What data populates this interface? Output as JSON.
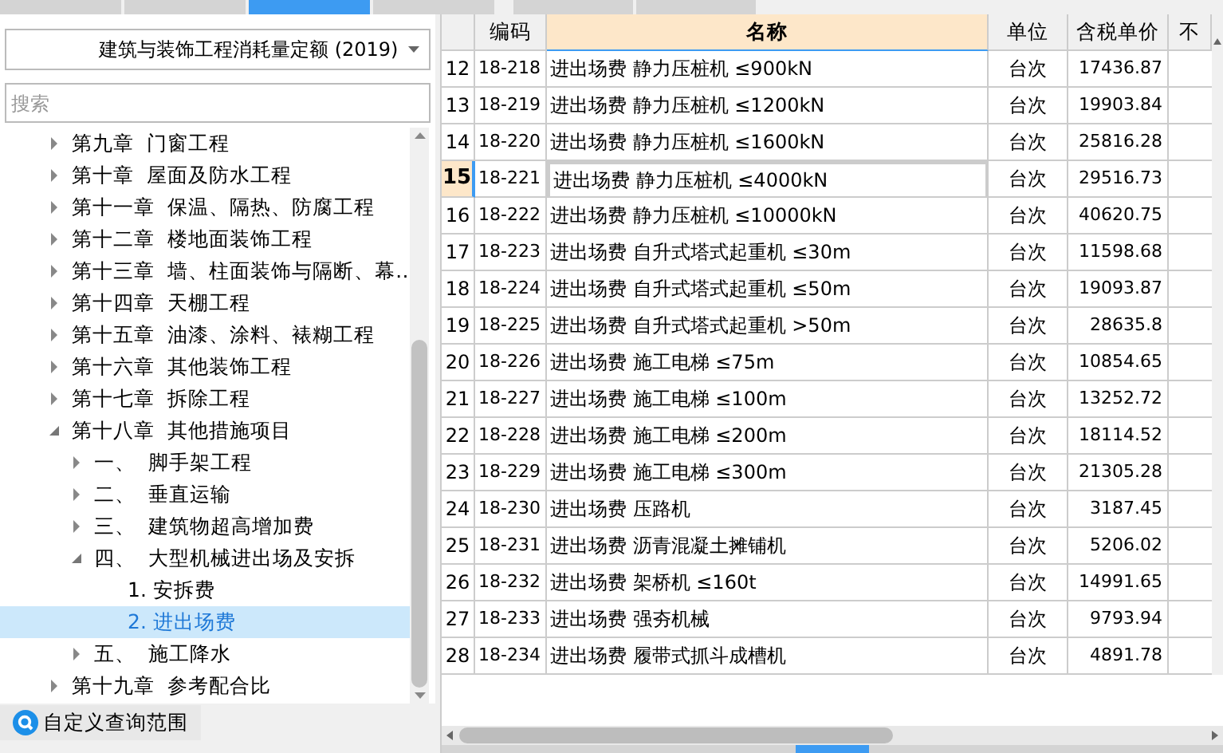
{
  "top_tabs": [
    {
      "selected": false
    },
    {
      "selected": false
    },
    {
      "selected": true
    },
    {
      "selected": false
    }
  ],
  "right_tabs": [
    {
      "selected": false
    },
    {
      "selected": false
    }
  ],
  "library_select": {
    "value": "建筑与装饰工程消耗量定额 (2019)"
  },
  "search": {
    "placeholder": "搜索"
  },
  "tree": [
    {
      "label": "第九章  门窗工程",
      "expanded": false,
      "selected": false
    },
    {
      "label": "第十章  屋面及防水工程",
      "expanded": false,
      "selected": false
    },
    {
      "label": "第十一章  保温、隔热、防腐工程",
      "expanded": false,
      "selected": false
    },
    {
      "label": "第十二章  楼地面装饰工程",
      "expanded": false,
      "selected": false
    },
    {
      "label": "第十三章  墙、柱面装饰与隔断、幕…",
      "expanded": false,
      "selected": false
    },
    {
      "label": "第十四章  天棚工程",
      "expanded": false,
      "selected": false
    },
    {
      "label": "第十五章  油漆、涂料、裱糊工程",
      "expanded": false,
      "selected": false
    },
    {
      "label": "第十六章  其他装饰工程",
      "expanded": false,
      "selected": false
    },
    {
      "label": "第十七章  拆除工程",
      "expanded": false,
      "selected": false
    },
    {
      "label": "第十八章  其他措施项目",
      "expanded": true,
      "selected": false,
      "children": [
        {
          "label": "一、  脚手架工程",
          "expanded": false,
          "selected": false
        },
        {
          "label": "二、  垂直运输",
          "expanded": false,
          "selected": false
        },
        {
          "label": "三、  建筑物超高增加费",
          "expanded": false,
          "selected": false
        },
        {
          "label": "四、  大型机械进出场及安拆",
          "expanded": true,
          "selected": false,
          "children": [
            {
              "label": "1. 安拆费",
              "selected": false
            },
            {
              "label": "2. 进出场费",
              "selected": true
            }
          ]
        },
        {
          "label": "五、  施工降水",
          "expanded": false,
          "selected": false
        }
      ]
    },
    {
      "label": "第十九章  参考配合比",
      "expanded": false,
      "selected": false
    }
  ],
  "custom_scope_button": {
    "label": "自定义查询范围"
  },
  "table": {
    "columns": [
      "编码",
      "名称",
      "单位",
      "含税单价",
      "不"
    ],
    "rows": [
      {
        "index": "12",
        "code": "18-218",
        "name": "进出场费 静力压桩机 ≤900kN",
        "unit": "台次",
        "price": "17436.87",
        "selected": false
      },
      {
        "index": "13",
        "code": "18-219",
        "name": "进出场费 静力压桩机 ≤1200kN",
        "unit": "台次",
        "price": "19903.84",
        "selected": false
      },
      {
        "index": "14",
        "code": "18-220",
        "name": "进出场费 静力压桩机 ≤1600kN",
        "unit": "台次",
        "price": "25816.28",
        "selected": false
      },
      {
        "index": "15",
        "code": "18-221",
        "name": "进出场费 静力压桩机 ≤4000kN",
        "unit": "台次",
        "price": "29516.73",
        "selected": true
      },
      {
        "index": "16",
        "code": "18-222",
        "name": "进出场费 静力压桩机 ≤10000kN",
        "unit": "台次",
        "price": "40620.75",
        "selected": false
      },
      {
        "index": "17",
        "code": "18-223",
        "name": "进出场费 自升式塔式起重机 ≤30m",
        "unit": "台次",
        "price": "11598.68",
        "selected": false
      },
      {
        "index": "18",
        "code": "18-224",
        "name": "进出场费 自升式塔式起重机 ≤50m",
        "unit": "台次",
        "price": "19093.87",
        "selected": false
      },
      {
        "index": "19",
        "code": "18-225",
        "name": "进出场费 自升式塔式起重机 >50m",
        "unit": "台次",
        "price": "28635.8",
        "selected": false
      },
      {
        "index": "20",
        "code": "18-226",
        "name": "进出场费 施工电梯 ≤75m",
        "unit": "台次",
        "price": "10854.65",
        "selected": false
      },
      {
        "index": "21",
        "code": "18-227",
        "name": "进出场费 施工电梯 ≤100m",
        "unit": "台次",
        "price": "13252.72",
        "selected": false
      },
      {
        "index": "22",
        "code": "18-228",
        "name": "进出场费 施工电梯 ≤200m",
        "unit": "台次",
        "price": "18114.52",
        "selected": false
      },
      {
        "index": "23",
        "code": "18-229",
        "name": "进出场费 施工电梯 ≤300m",
        "unit": "台次",
        "price": "21305.28",
        "selected": false
      },
      {
        "index": "24",
        "code": "18-230",
        "name": "进出场费 压路机",
        "unit": "台次",
        "price": "3187.45",
        "selected": false
      },
      {
        "index": "25",
        "code": "18-231",
        "name": "进出场费 沥青混凝土摊铺机",
        "unit": "台次",
        "price": "5206.02",
        "selected": false
      },
      {
        "index": "26",
        "code": "18-232",
        "name": "进出场费 架桥机 ≤160t",
        "unit": "台次",
        "price": "14991.65",
        "selected": false
      },
      {
        "index": "27",
        "code": "18-233",
        "name": "进出场费 强夯机械",
        "unit": "台次",
        "price": "9793.94",
        "selected": false
      },
      {
        "index": "28",
        "code": "18-234",
        "name": "进出场费 履带式抓斗成槽机",
        "unit": "台次",
        "price": "4891.78",
        "selected": false
      }
    ]
  }
}
